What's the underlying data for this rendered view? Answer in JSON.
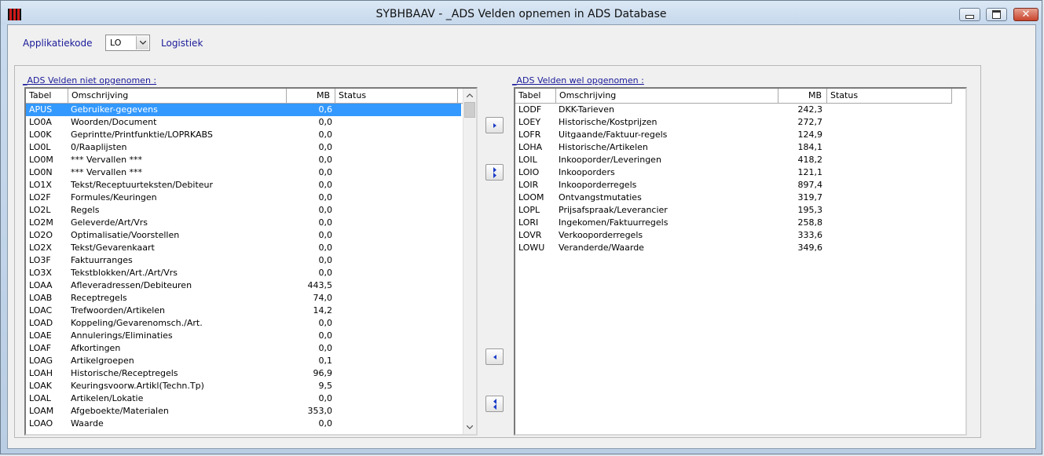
{
  "window": {
    "title": "SYBHBAAV - _ADS Velden opnemen in ADS Database"
  },
  "header": {
    "app_label": "Applikatiekode",
    "app_code": "LO",
    "app_name": "Logistiek"
  },
  "left": {
    "caption": "_ADS Velden niet opgenomen :",
    "columns": [
      "Tabel",
      "Omschrijving",
      "MB",
      "Status"
    ],
    "rows": [
      [
        "APUS",
        "Gebruiker-gegevens",
        "0,6",
        ""
      ],
      [
        "LO0A",
        "Woorden/Document",
        "0,0",
        ""
      ],
      [
        "LO0K",
        "Geprintte/Printfunktie/LOPRKABS",
        "0,0",
        ""
      ],
      [
        "LO0L",
        "0/Raaplijsten",
        "0,0",
        ""
      ],
      [
        "LO0M",
        "*** Vervallen ***",
        "0,0",
        ""
      ],
      [
        "LO0N",
        "*** Vervallen ***",
        "0,0",
        ""
      ],
      [
        "LO1X",
        "Tekst/Receptuurteksten/Debiteur",
        "0,0",
        ""
      ],
      [
        "LO2F",
        "Formules/Keuringen",
        "0,0",
        ""
      ],
      [
        "LO2L",
        "Regels",
        "0,0",
        ""
      ],
      [
        "LO2M",
        "Geleverde/Art/Vrs",
        "0,0",
        ""
      ],
      [
        "LO2O",
        "Optimalisatie/Voorstellen",
        "0,0",
        ""
      ],
      [
        "LO2X",
        "Tekst/Gevarenkaart",
        "0,0",
        ""
      ],
      [
        "LO3F",
        "Faktuurranges",
        "0,0",
        ""
      ],
      [
        "LO3X",
        "Tekstblokken/Art./Art/Vrs",
        "0,0",
        ""
      ],
      [
        "LOAA",
        "Afleveradressen/Debiteuren",
        "443,5",
        ""
      ],
      [
        "LOAB",
        "Receptregels",
        "74,0",
        ""
      ],
      [
        "LOAC",
        "Trefwoorden/Artikelen",
        "14,2",
        ""
      ],
      [
        "LOAD",
        "Koppeling/Gevarenomsch./Art.",
        "0,0",
        ""
      ],
      [
        "LOAE",
        "Annulerings/Eliminaties",
        "0,0",
        ""
      ],
      [
        "LOAF",
        "Afkortingen",
        "0,0",
        ""
      ],
      [
        "LOAG",
        "Artikelgroepen",
        "0,1",
        ""
      ],
      [
        "LOAH",
        "Historische/Receptregels",
        "96,9",
        ""
      ],
      [
        "LOAK",
        "Keuringsvoorw.Artikl(Techn.Tp)",
        "9,5",
        ""
      ],
      [
        "LOAL",
        "Artikelen/Lokatie",
        "0,0",
        ""
      ],
      [
        "LOAM",
        "Afgeboekte/Materialen",
        "353,0",
        ""
      ],
      [
        "LOAO",
        "Waarde",
        "0,0",
        ""
      ]
    ],
    "selected_index": 0
  },
  "right": {
    "caption": "_ADS Velden wel opgenomen :",
    "columns": [
      "Tabel",
      "Omschrijving",
      "MB",
      "Status"
    ],
    "rows": [
      [
        "LODF",
        "DKK-Tarieven",
        "242,3",
        ""
      ],
      [
        "LOEY",
        "Historische/Kostprijzen",
        "272,7",
        ""
      ],
      [
        "LOFR",
        "Uitgaande/Faktuur-regels",
        "124,9",
        ""
      ],
      [
        "LOHA",
        "Historische/Artikelen",
        "184,1",
        ""
      ],
      [
        "LOIL",
        "Inkooporder/Leveringen",
        "418,2",
        ""
      ],
      [
        "LOIO",
        "Inkooporders",
        "121,1",
        ""
      ],
      [
        "LOIR",
        "Inkooporderregels",
        "897,4",
        ""
      ],
      [
        "LOOM",
        "Ontvangstmutaties",
        "319,7",
        ""
      ],
      [
        "LOPL",
        "Prijsafspraak/Leverancier",
        "195,3",
        ""
      ],
      [
        "LORI",
        "Ingekomen/Faktuurregels",
        "258,8",
        ""
      ],
      [
        "LOVR",
        "Verkooporderregels",
        "333,6",
        ""
      ],
      [
        "LOWU",
        "Veranderde/Waarde",
        "349,6",
        ""
      ]
    ]
  },
  "icons": {
    "move_right": "arrow-right-icon",
    "move_all_right": "double-arrow-right-icon",
    "move_left": "arrow-left-icon",
    "move_all_left": "double-arrow-left-icon"
  },
  "colors": {
    "selection": "#3399ff",
    "label_text": "#1a1a9a",
    "arrow_blue": "#1a3cc8"
  }
}
